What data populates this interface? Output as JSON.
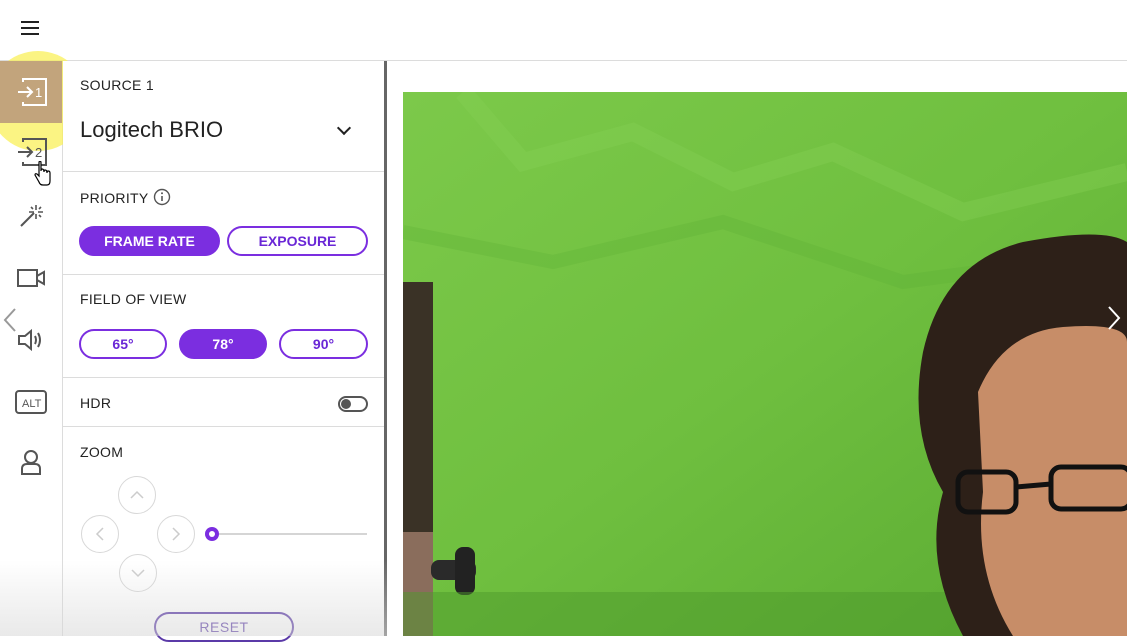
{
  "rail": {
    "items": [
      {
        "icon": "source-1-icon",
        "label": "1"
      },
      {
        "icon": "source-2-icon",
        "label": "2"
      },
      {
        "icon": "magic-wand-icon"
      },
      {
        "icon": "camera-icon"
      },
      {
        "icon": "speaker-icon"
      },
      {
        "icon": "alt-icon",
        "label": "ALT"
      },
      {
        "icon": "user-icon"
      }
    ]
  },
  "source": {
    "title": "SOURCE 1",
    "device": "Logitech BRIO"
  },
  "priority": {
    "title": "PRIORITY",
    "options": [
      "FRAME RATE",
      "EXPOSURE"
    ],
    "selected": "FRAME RATE"
  },
  "field_of_view": {
    "title": "FIELD OF VIEW",
    "options": [
      "65°",
      "78°",
      "90°"
    ],
    "selected": "78°"
  },
  "hdr": {
    "title": "HDR",
    "enabled": false
  },
  "zoom": {
    "title": "ZOOM",
    "level": 0,
    "reset_label": "RESET"
  },
  "colors": {
    "accent": "#7b2ee0",
    "active_rail": "#c2a47c",
    "greenscreen": "#6fc03f"
  }
}
